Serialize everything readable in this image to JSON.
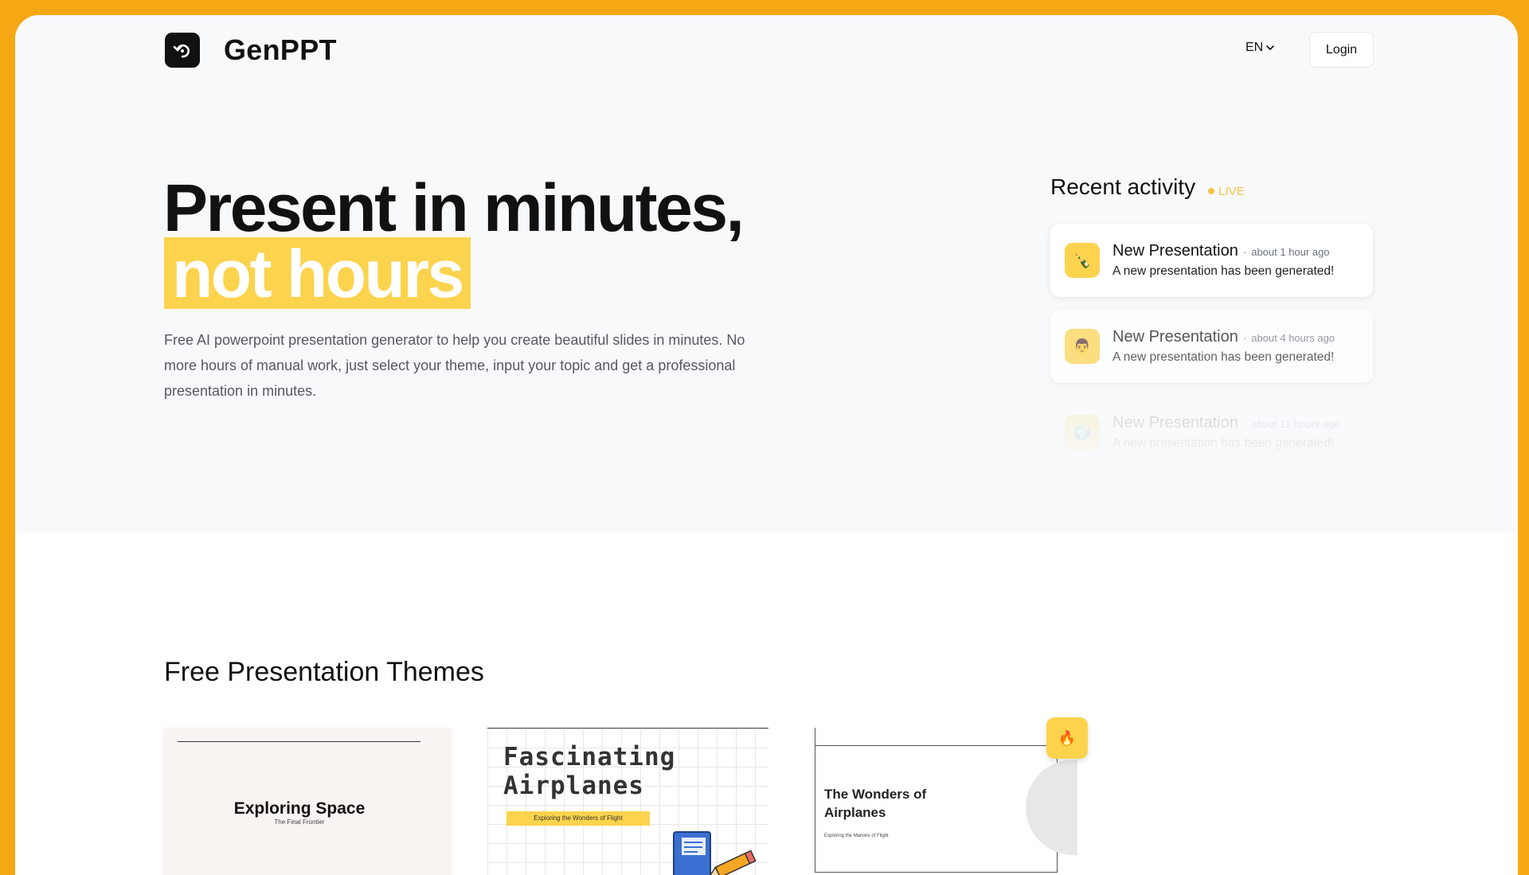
{
  "header": {
    "brand": "GenPPT",
    "language": "EN",
    "login_label": "Login"
  },
  "hero": {
    "title_line1": "Present in minutes,",
    "title_highlight": "not hours",
    "description": "Free AI powerpoint presentation generator to help you create beautiful slides in minutes. No more hours of manual work, just select your theme, input your topic and get a professional presentation in minutes."
  },
  "activity": {
    "title": "Recent activity",
    "live_label": "LIVE",
    "items": [
      {
        "name": "New Presentation",
        "time": "about 1 hour ago",
        "desc": "A new presentation has been generated!"
      },
      {
        "name": "New Presentation",
        "time": "about 4 hours ago",
        "desc": "A new presentation has been generated!"
      },
      {
        "name": "New Presentation",
        "time": "about 11 hours ago",
        "desc": "A new presentation has been generated!"
      }
    ]
  },
  "themes": {
    "title": "Free Presentation Themes",
    "cards": [
      {
        "title": "Exploring Space",
        "subtitle": "The Final Frontier"
      },
      {
        "title": "Fascinating Airplanes",
        "subtitle": "Exploring the Wonders of Flight"
      },
      {
        "title": "The Wonders of Airplanes",
        "subtitle": "Exploring the Marvels of Flight"
      }
    ]
  },
  "colors": {
    "accent": "#fcd34d",
    "frame": "#f5a814"
  }
}
